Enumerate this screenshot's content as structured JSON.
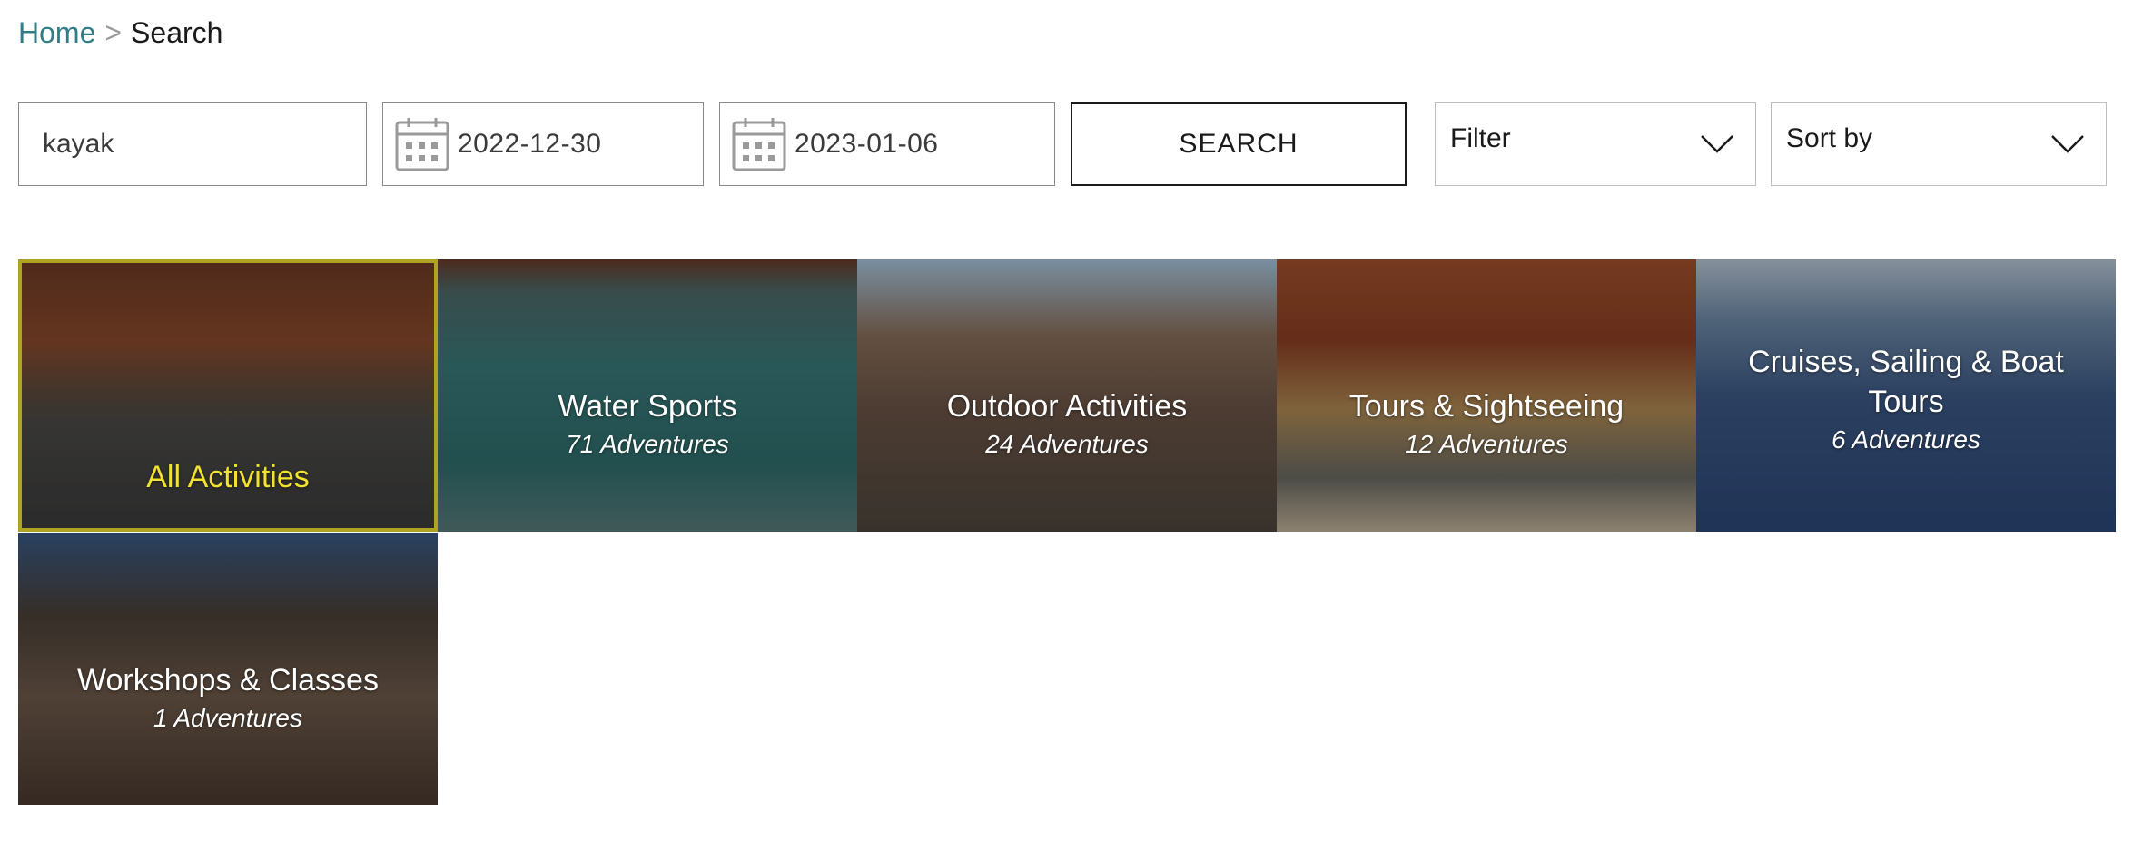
{
  "breadcrumb": {
    "home": "Home",
    "separator": ">",
    "current": "Search"
  },
  "search": {
    "keyword": "kayak",
    "start_date": "2022-12-30",
    "end_date": "2023-01-06",
    "button_label": "SEARCH",
    "filter_label": "Filter",
    "sort_label": "Sort by"
  },
  "categories": [
    {
      "title": "All Activities",
      "count": "",
      "selected": true
    },
    {
      "title": "Water Sports",
      "count": "71 Adventures"
    },
    {
      "title": "Outdoor Activities",
      "count": "24 Adventures"
    },
    {
      "title": "Tours & Sightseeing",
      "count": "12 Adventures"
    },
    {
      "title": "Cruises, Sailing & Boat Tours",
      "count": "6 Adventures"
    },
    {
      "title": "Workshops & Classes",
      "count": "1 Adventures"
    }
  ],
  "colors": {
    "accent_link": "#2f7d86",
    "selected_highlight": "#f2e230"
  },
  "icons": {
    "date": "calendar-icon",
    "dropdown": "chevron-down-icon"
  }
}
